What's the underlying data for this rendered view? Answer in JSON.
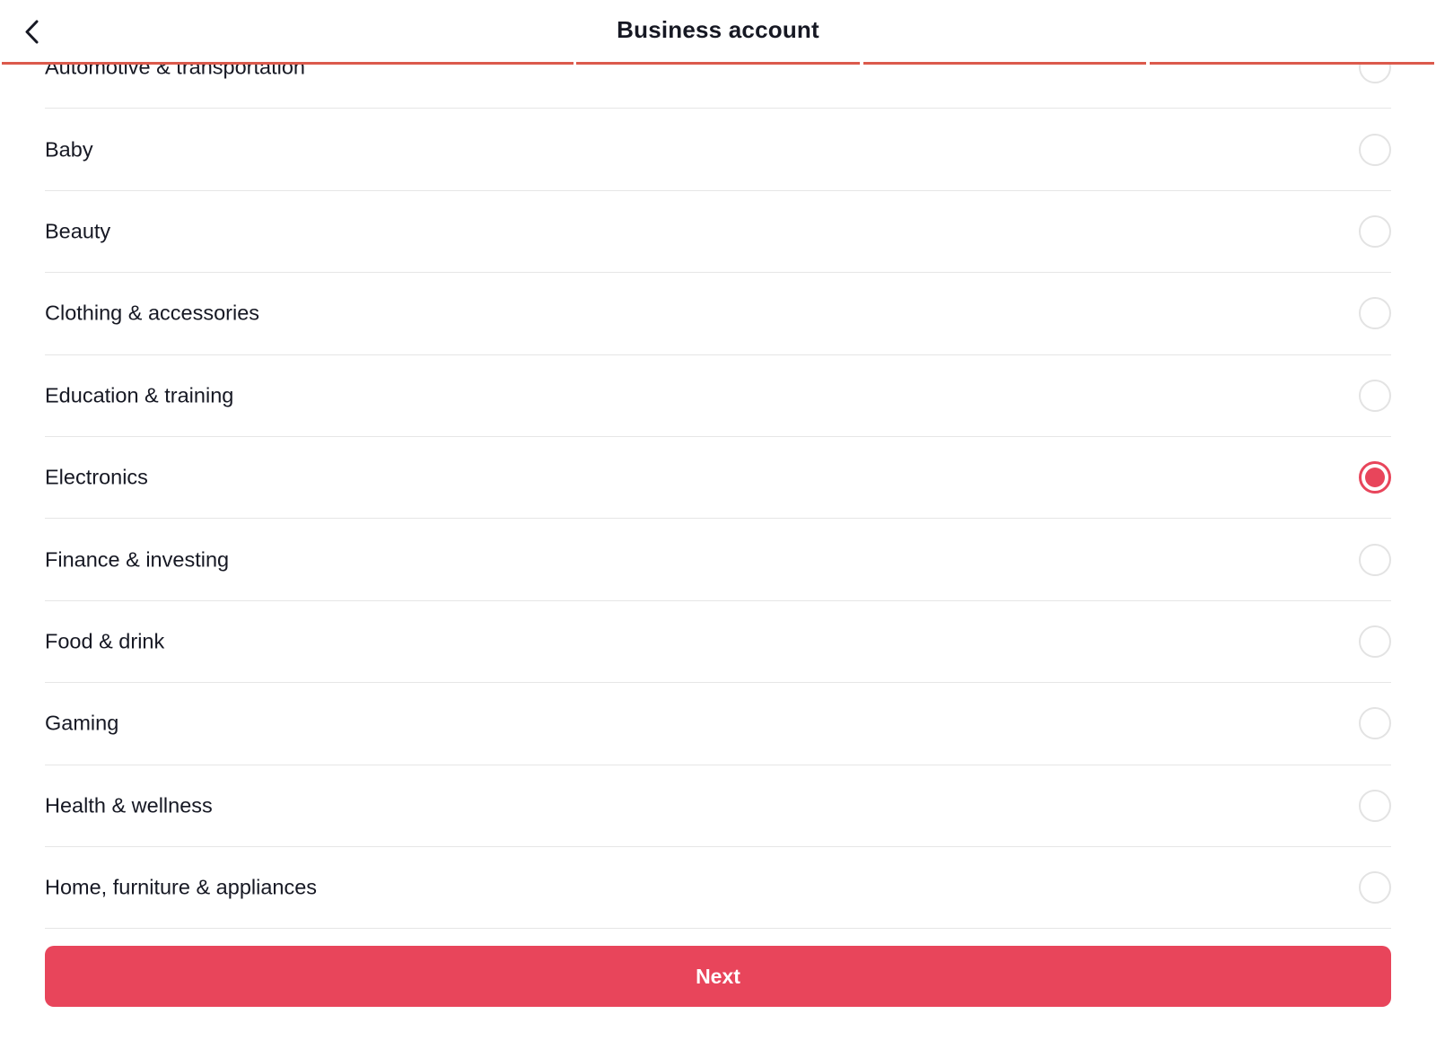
{
  "header": {
    "title": "Business account",
    "back_icon": "chevron-left-icon"
  },
  "progress": {
    "steps_total": 4,
    "steps_completed": 4,
    "color": "#dc5a4c"
  },
  "categories": [
    {
      "label": "Automotive & transportation",
      "selected": false
    },
    {
      "label": "Baby",
      "selected": false
    },
    {
      "label": "Beauty",
      "selected": false
    },
    {
      "label": "Clothing & accessories",
      "selected": false
    },
    {
      "label": "Education & training",
      "selected": false
    },
    {
      "label": "Electronics",
      "selected": true
    },
    {
      "label": "Finance & investing",
      "selected": false
    },
    {
      "label": "Food & drink",
      "selected": false
    },
    {
      "label": "Gaming",
      "selected": false
    },
    {
      "label": "Health & wellness",
      "selected": false
    },
    {
      "label": "Home, furniture & appliances",
      "selected": false
    }
  ],
  "footer": {
    "next_label": "Next"
  },
  "colors": {
    "accent": "#e8455b"
  }
}
